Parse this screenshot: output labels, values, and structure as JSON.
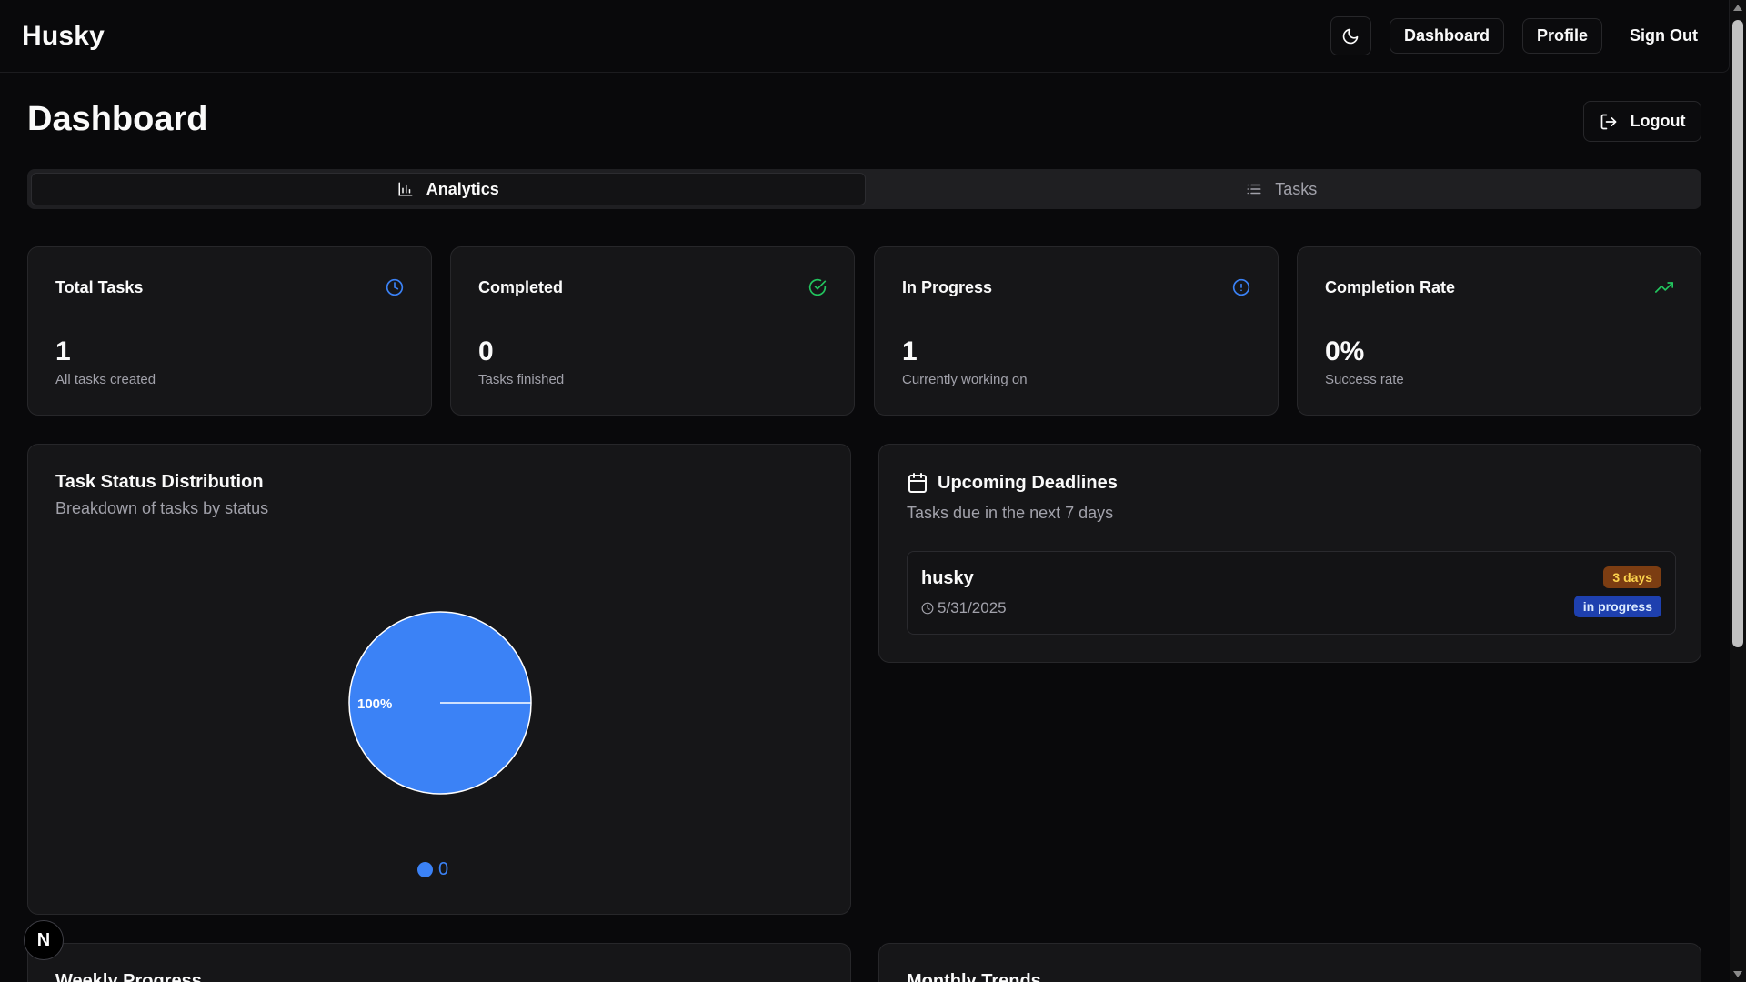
{
  "app": {
    "brand": "Husky"
  },
  "nav": {
    "dashboard": "Dashboard",
    "profile": "Profile",
    "sign_out": "Sign Out"
  },
  "page": {
    "title": "Dashboard",
    "logout": "Logout"
  },
  "tabs": [
    {
      "label": "Analytics",
      "icon": "bar-chart-icon",
      "active": true
    },
    {
      "label": "Tasks",
      "icon": "list-icon",
      "active": false
    }
  ],
  "stats": [
    {
      "title": "Total Tasks",
      "value": "1",
      "sub": "All tasks created",
      "icon": "clock-icon",
      "color": "#3b82f6"
    },
    {
      "title": "Completed",
      "value": "0",
      "sub": "Tasks finished",
      "icon": "check-circle-icon",
      "color": "#22c55e"
    },
    {
      "title": "In Progress",
      "value": "1",
      "sub": "Currently working on",
      "icon": "alert-circle-icon",
      "color": "#3b82f6"
    },
    {
      "title": "Completion Rate",
      "value": "0%",
      "sub": "Success rate",
      "icon": "trending-up-icon",
      "color": "#22c55e"
    }
  ],
  "distribution": {
    "title": "Task Status Distribution",
    "subtitle": "Breakdown of tasks by status",
    "slice_label": "100%",
    "legend_label": "0"
  },
  "chart_data": {
    "type": "pie",
    "categories": [
      "0"
    ],
    "values": [
      100
    ],
    "colors": [
      "#3b82f6"
    ],
    "data_labels": [
      "100%"
    ],
    "title": "Task Status Distribution",
    "legend": "bottom"
  },
  "deadlines": {
    "title": "Upcoming Deadlines",
    "subtitle": "Tasks due in the next 7 days",
    "items": [
      {
        "name": "husky",
        "date": "5/31/2025",
        "days_badge": "3 days",
        "status_badge": "in progress"
      }
    ]
  },
  "bottom_cards": {
    "weekly": "Weekly Progress",
    "monthly": "Monthly Trends"
  },
  "fab": {
    "label": "N"
  },
  "colors": {
    "background": "#09090b",
    "card": "#161618",
    "accent": "#3b82f6",
    "success": "#22c55e"
  }
}
